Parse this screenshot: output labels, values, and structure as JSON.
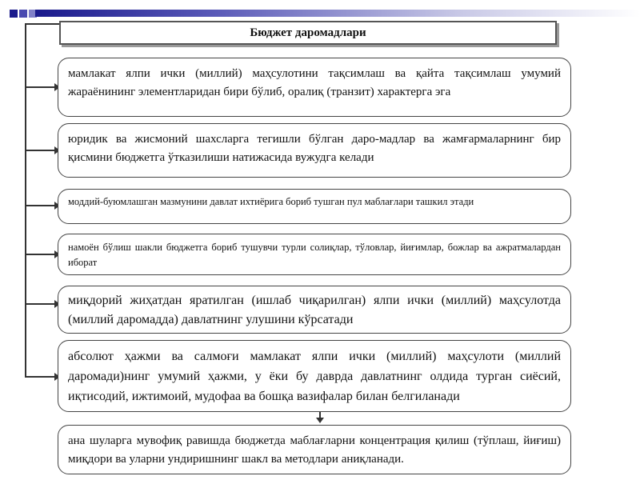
{
  "title": "Бюджет даромадлари",
  "boxes": [
    "мамлакат ялпи ички (миллий) маҳсулотини тақсимлаш ва қайта тақсимлаш умумий жараёнининг элементларидан бири бўлиб,  оралиқ (транзит) характерга эга",
    " юридик ва жисмоний шахсларга тегишли бўлган даро-мадлар ва жамғармаларнинг бир қисмини бюджетга ўтказилиши натижасида вужудга келади",
    "моддий-буюмлашган мазмунини давлат ихтиёрига бориб тушган пул маблағлари ташкил этади",
    "намоён бўлиш шакли бюджетга бориб тушувчи турли солиқлар, тўловлар, йиғимлар, божлар ва ажратмалардан иборат",
    "миқдорий жиҳатдан яратилган (ишлаб чиқарилган) ялпи ички (миллий) маҳсулотда (миллий даромадда) давлатнинг улушини кўрсатади",
    "абсолют ҳажми ва салмоғи мамлакат ялпи ички (миллий) маҳсулоти (миллий даромади)нинг умумий ҳажми,   у ёки бу даврда давлатнинг олдида турган сиёсий, иқтисодий, ижтимоий, мудофаа ва бошқа вазифалар билан белгиланади",
    "ана шуларга мувофиқ равишда бюджетда маблағларни концентрация қилиш (тўплаш, йиғиш) миқдори ва уларни ундиришнинг шакл ва методлари аниқланади."
  ]
}
